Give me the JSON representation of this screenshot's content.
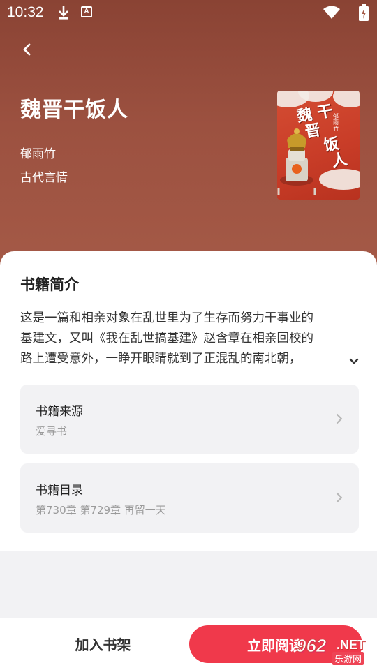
{
  "status_bar": {
    "time": "10:32",
    "icons": [
      "download-icon",
      "a-notification-icon",
      "wifi-icon",
      "battery-charging-icon"
    ]
  },
  "header": {
    "back_icon": "chevron-left-icon"
  },
  "book": {
    "title": "魏晋干饭人",
    "author": "郁雨竹",
    "genre": "古代言情",
    "cover": {
      "title_art": "魏晋干饭人",
      "author_art": "郁雨竹·著"
    }
  },
  "intro": {
    "heading": "书籍简介",
    "lines": [
      "这是一篇和相亲对象在乱世里为了生存而努力干事业的",
      "基建文，又叫《我在乱世搞基建》赵含章在相亲回校的",
      "路上遭受意外，一睁开眼睛就到了正混乱的南北朝，"
    ],
    "expand_icon": "chevron-down-icon"
  },
  "source_card": {
    "title": "书籍来源",
    "value": "爱寻书"
  },
  "catalog_card": {
    "title": "书籍目录",
    "value": "第730章 第729章 再留一天"
  },
  "bottom": {
    "add_shelf": "加入书架",
    "read_now": "立即阅读"
  },
  "watermark": {
    "num": "962",
    "net": ".NET",
    "cn": "乐游网"
  },
  "colors": {
    "hero": "#9c5140",
    "accent": "#f0394b",
    "card_bg": "#f2f2f4"
  }
}
